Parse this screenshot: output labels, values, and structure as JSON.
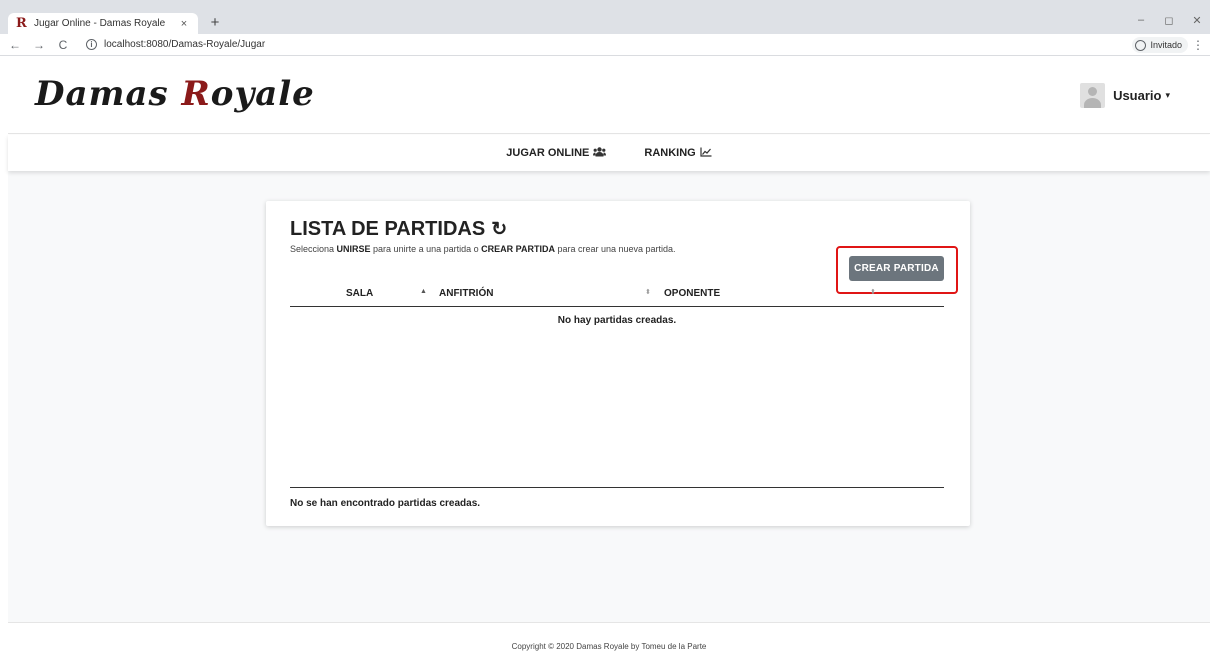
{
  "browser": {
    "tab_title": "Jugar Online - Damas Royale",
    "tab_favicon": "R",
    "tab_close": "×",
    "new_tab": "+",
    "url": "localhost:8080/Damas-Royale/Jugar",
    "profile_label": "Invitado",
    "nav_back": "←",
    "nav_forward": "→",
    "nav_reload": "C",
    "info": "i",
    "menu": "⋮",
    "minimize": "–",
    "restore": "◻",
    "close": "✕"
  },
  "header": {
    "logo_d": "D",
    "logo_rest1": "amas ",
    "logo_r": "R",
    "logo_rest2": "oyale",
    "user_name": "Usuario",
    "caret": "▾"
  },
  "nav": {
    "items": [
      {
        "label": "JUGAR ONLINE",
        "icon": "users-icon",
        "glyph": "👥"
      },
      {
        "label": "RANKING",
        "icon": "chart-line-icon",
        "glyph": "📈"
      }
    ]
  },
  "card": {
    "title": "LISTA DE PARTIDAS",
    "refresh_glyph": "↻",
    "subtitle_pre": "Selecciona ",
    "subtitle_b1": "UNIRSE",
    "subtitle_mid": " para unirte a una partida o ",
    "subtitle_b2": "CREAR PARTIDA",
    "subtitle_post": " para crear una nueva partida.",
    "create_button": "CREAR PARTIDA",
    "columns": [
      "SALA",
      "ANFITRIÓN",
      "OPONENTE"
    ],
    "sort_asc": "▲",
    "sort_both": "⬍",
    "empty_message": "No hay partidas creadas.",
    "table_info": "No se han encontrado partidas creadas."
  },
  "footer": {
    "copyright": "Copyright © 2020 Damas Royale by Tomeu de la Parte"
  },
  "colors": {
    "accent_red": "#8b1a1a",
    "button_gray": "#6c757d",
    "highlight": "#e01515"
  }
}
